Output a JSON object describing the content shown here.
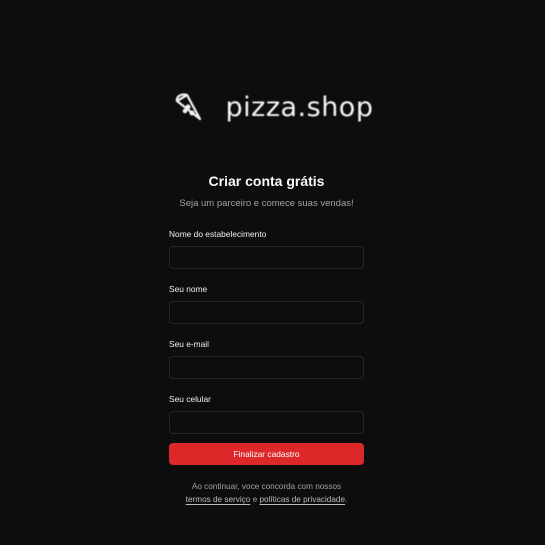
{
  "brand": {
    "icon": "pizza-slice-icon",
    "name": "pizza.shop"
  },
  "form": {
    "title": "Criar conta grátis",
    "subtitle": "Seja um parceiro e comece suas vendas!",
    "fields": [
      {
        "label": "Nome do estabelecimento",
        "value": "",
        "placeholder": ""
      },
      {
        "label": "Seu nome",
        "value": "",
        "placeholder": ""
      },
      {
        "label": "Seu e-mail",
        "value": "",
        "placeholder": ""
      },
      {
        "label": "Seu celular",
        "value": "",
        "placeholder": ""
      }
    ],
    "submit_label": "Finalizar cadastro"
  },
  "legal": {
    "line1": "Ao continuar, voce concorda com nossos",
    "terms_link": "termos de serviço",
    "connector": "e",
    "privacy_link": "políticas de privacidade",
    "end": "."
  },
  "colors": {
    "background": "#0d0d0d",
    "accent": "#dc2828",
    "input_border": "#262626",
    "muted_text": "#a3a3a3"
  }
}
